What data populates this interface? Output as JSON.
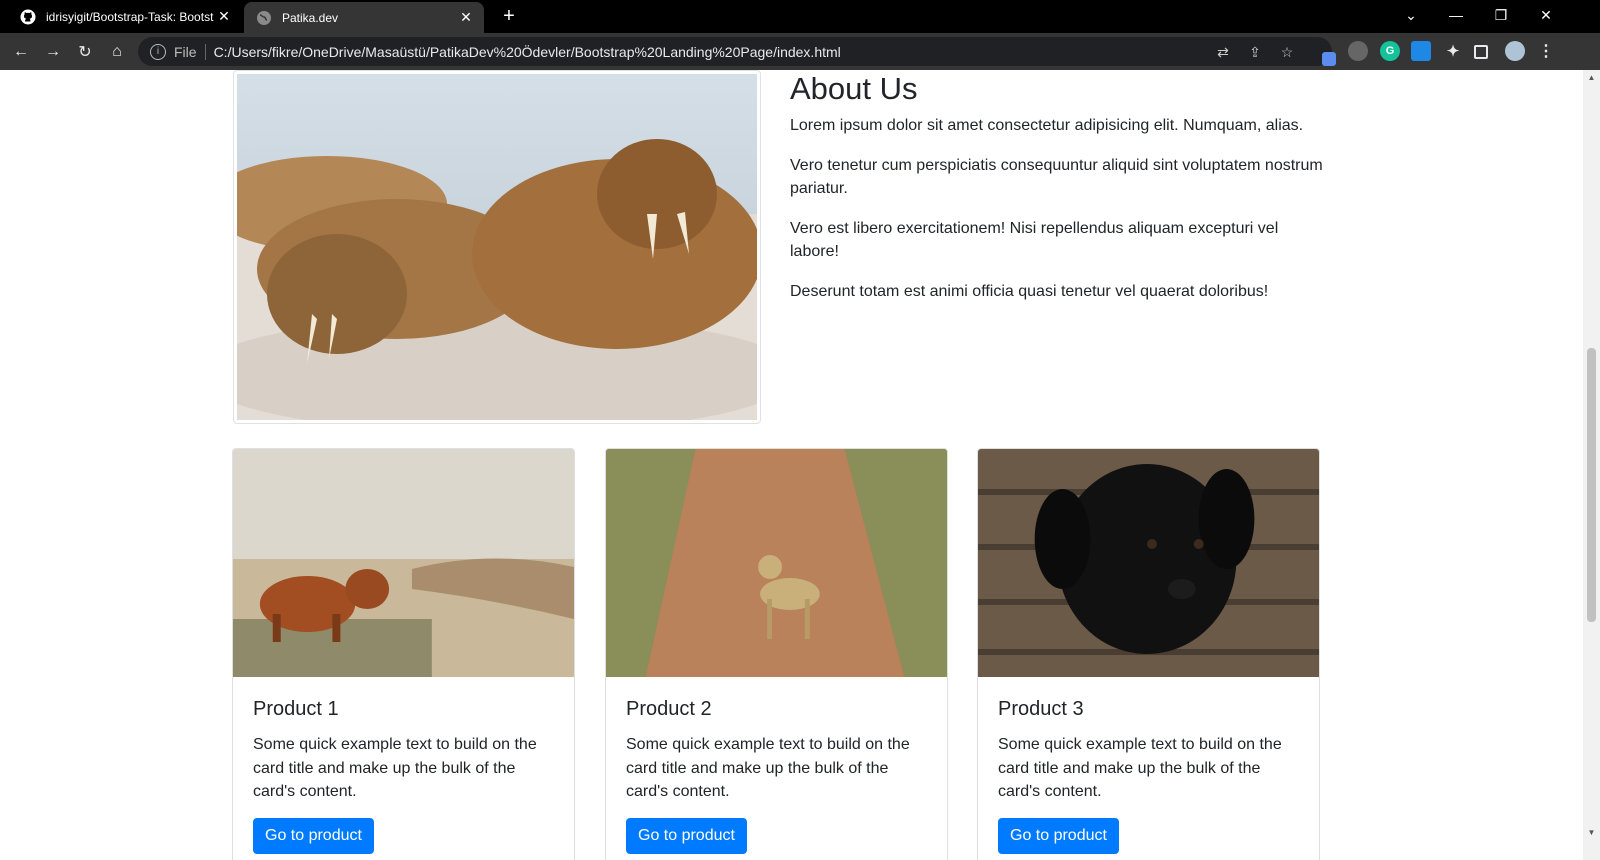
{
  "browser": {
    "tabs": [
      {
        "title": "idrisyigit/Bootstrap-Task: Bootstrap",
        "icon": "github-icon",
        "active": false
      },
      {
        "title": "Patika.dev",
        "icon": "globe-icon",
        "active": true
      }
    ],
    "address": {
      "scheme_label": "File",
      "url": "C:/Users/fikre/OneDrive/Masaüstü/PatikaDev%20Ödevler/Bootstrap%20Landing%20Page/index.html"
    }
  },
  "about": {
    "heading": "About Us",
    "paragraphs": [
      "Lorem ipsum dolor sit amet consectetur adipisicing elit. Numquam, alias.",
      "Vero tenetur cum perspiciatis consequuntur aliquid sint voluptatem nostrum pariatur.",
      "Vero est libero exercitationem! Nisi repellendus aliquam excepturi vel labore!",
      "Deserunt totam est animi officia quasi tenetur vel quaerat doloribus!"
    ]
  },
  "products": [
    {
      "title": "Product 1",
      "text": "Some quick example text to build on the card title and make up the bulk of the card's content.",
      "button": "Go to product"
    },
    {
      "title": "Product 2",
      "text": "Some quick example text to build on the card title and make up the bulk of the card's content.",
      "button": "Go to product"
    },
    {
      "title": "Product 3",
      "text": "Some quick example text to build on the card title and make up the bulk of the card's content.",
      "button": "Go to product"
    }
  ],
  "colors": {
    "primary_button": "#007bff",
    "toolbar": "#353535",
    "tabstrip": "#000000"
  }
}
